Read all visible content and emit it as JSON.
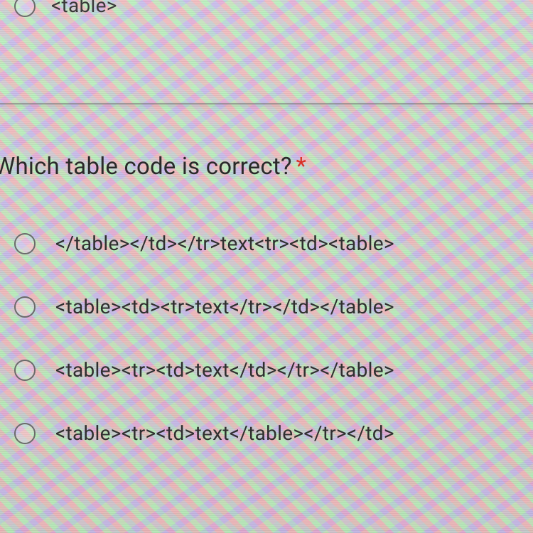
{
  "previous_question": {
    "last_option_label": "<table>"
  },
  "question": {
    "text": "Which table code is correct?",
    "required_marker": "*",
    "options": [
      {
        "label": "</table></td></tr>text<tr><td><table>"
      },
      {
        "label": "<table><td><tr>text</tr></td></table>"
      },
      {
        "label": "<table><tr><td>text</td></tr></table>"
      },
      {
        "label": "<table><tr><td>text</table></tr></td>"
      }
    ]
  }
}
